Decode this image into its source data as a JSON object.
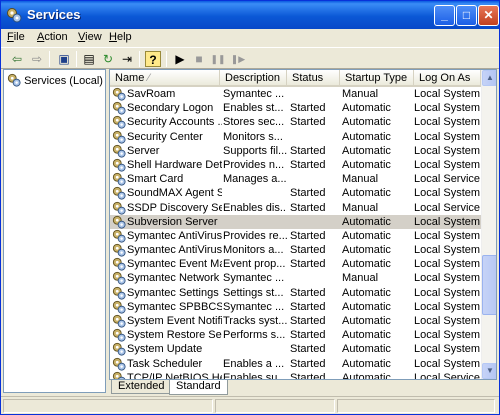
{
  "window": {
    "title": "Services",
    "icon": "gears-icon"
  },
  "title_buttons": {
    "minimize": "_",
    "maximize": "□",
    "close": "✕"
  },
  "menu": [
    {
      "label": "File",
      "mnemonic": "F",
      "rest": "ile"
    },
    {
      "label": "Action",
      "mnemonic": "A",
      "rest": "ction"
    },
    {
      "label": "View",
      "mnemonic": "V",
      "rest": "iew"
    },
    {
      "label": "Help",
      "mnemonic": "H",
      "rest": "elp"
    }
  ],
  "toolbar": [
    {
      "name": "back-arrow-icon",
      "glyph": "⇦"
    },
    {
      "name": "forward-arrow-icon",
      "glyph": "⇨"
    },
    {
      "name": "show-hide-console-tree-icon",
      "glyph": "▣"
    },
    {
      "name": "properties-icon",
      "glyph": "▤"
    },
    {
      "name": "refresh-icon",
      "glyph": "↻"
    },
    {
      "name": "export-list-icon",
      "glyph": "⇥"
    },
    {
      "name": "help-icon",
      "glyph": "?"
    },
    {
      "name": "start-service-icon",
      "glyph": "▶"
    },
    {
      "name": "stop-service-icon",
      "glyph": "■"
    },
    {
      "name": "pause-service-icon",
      "glyph": "❚❚"
    },
    {
      "name": "restart-service-icon",
      "glyph": "❚▶"
    }
  ],
  "tree": {
    "label": "Services (Local)"
  },
  "columns": [
    "Name",
    "Description",
    "Status",
    "Startup Type",
    "Log On As"
  ],
  "sort_indicator": "⁄",
  "rows": [
    {
      "name": "SavRoam",
      "description": "Symantec ...",
      "status": "",
      "startup": "Manual",
      "logon": "Local System"
    },
    {
      "name": "Secondary Logon",
      "description": "Enables st...",
      "status": "Started",
      "startup": "Automatic",
      "logon": "Local System"
    },
    {
      "name": "Security Accounts ...",
      "description": "Stores sec...",
      "status": "Started",
      "startup": "Automatic",
      "logon": "Local System"
    },
    {
      "name": "Security Center",
      "description": "Monitors s...",
      "status": "",
      "startup": "Automatic",
      "logon": "Local System"
    },
    {
      "name": "Server",
      "description": "Supports fil...",
      "status": "Started",
      "startup": "Automatic",
      "logon": "Local System"
    },
    {
      "name": "Shell Hardware Det...",
      "description": "Provides n...",
      "status": "Started",
      "startup": "Automatic",
      "logon": "Local System"
    },
    {
      "name": "Smart Card",
      "description": "Manages a...",
      "status": "",
      "startup": "Manual",
      "logon": "Local Service"
    },
    {
      "name": "SoundMAX Agent S...",
      "description": "",
      "status": "Started",
      "startup": "Automatic",
      "logon": "Local System"
    },
    {
      "name": "SSDP Discovery Ser...",
      "description": "Enables dis...",
      "status": "Started",
      "startup": "Manual",
      "logon": "Local Service"
    },
    {
      "name": "Subversion Server",
      "description": "",
      "status": "",
      "startup": "Automatic",
      "logon": "Local System",
      "selected": true
    },
    {
      "name": "Symantec AntiVirus",
      "description": "Provides re...",
      "status": "Started",
      "startup": "Automatic",
      "logon": "Local System"
    },
    {
      "name": "Symantec AntiVirus ...",
      "description": "Monitors a...",
      "status": "Started",
      "startup": "Automatic",
      "logon": "Local System"
    },
    {
      "name": "Symantec Event Ma...",
      "description": "Event prop...",
      "status": "Started",
      "startup": "Automatic",
      "logon": "Local System"
    },
    {
      "name": "Symantec Network ...",
      "description": "Symantec ...",
      "status": "",
      "startup": "Manual",
      "logon": "Local System"
    },
    {
      "name": "Symantec Settings ...",
      "description": "Settings st...",
      "status": "Started",
      "startup": "Automatic",
      "logon": "Local System"
    },
    {
      "name": "Symantec SPBBCSvc",
      "description": "Symantec ...",
      "status": "Started",
      "startup": "Automatic",
      "logon": "Local System"
    },
    {
      "name": "System Event Notifi...",
      "description": "Tracks syst...",
      "status": "Started",
      "startup": "Automatic",
      "logon": "Local System"
    },
    {
      "name": "System Restore Ser...",
      "description": "Performs s...",
      "status": "Started",
      "startup": "Automatic",
      "logon": "Local System"
    },
    {
      "name": "System Update",
      "description": "",
      "status": "Started",
      "startup": "Automatic",
      "logon": "Local System"
    },
    {
      "name": "Task Scheduler",
      "description": "Enables a ...",
      "status": "Started",
      "startup": "Automatic",
      "logon": "Local System"
    },
    {
      "name": "TCP/IP NetBIOS Hel...",
      "description": "Enables su...",
      "status": "Started",
      "startup": "Automatic",
      "logon": "Local Service"
    }
  ],
  "tabs": [
    {
      "label": "Extended",
      "active": false
    },
    {
      "label": "Standard",
      "active": true
    }
  ],
  "scrollbar": {
    "up": "▲",
    "down": "▼",
    "position_fraction": 0.72
  },
  "colors": {
    "title_bar": "#0b58d6",
    "selected_row": "#d4d0c8",
    "window_bg": "#ece9d8"
  }
}
